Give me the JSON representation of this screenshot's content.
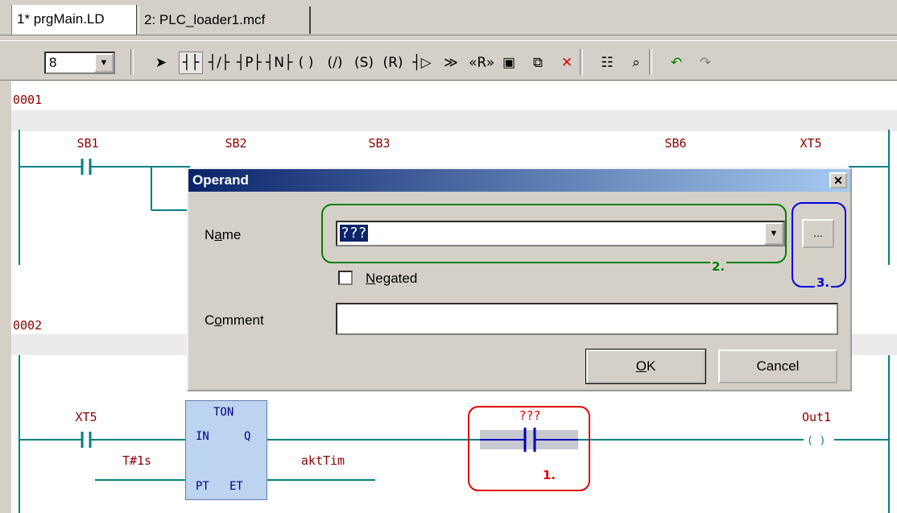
{
  "tabs": [
    {
      "label": "1* prgMain.LD",
      "active": true
    },
    {
      "label": "2: PLC_loader1.mcf",
      "active": false
    }
  ],
  "toolbar": {
    "zoom_value": "8",
    "tools": [
      {
        "name": "pointer-tool",
        "glyph": "➤"
      },
      {
        "name": "contact-tool",
        "glyph": "┤├"
      },
      {
        "name": "negated-contact-tool",
        "glyph": "┤/├"
      },
      {
        "name": "positive-edge-contact-tool",
        "glyph": "┤P├"
      },
      {
        "name": "negative-edge-contact-tool",
        "glyph": "┤N├"
      },
      {
        "name": "coil-tool",
        "glyph": "( )"
      },
      {
        "name": "negated-coil-tool",
        "glyph": "(/)"
      },
      {
        "name": "set-coil-tool",
        "glyph": "(S)"
      },
      {
        "name": "reset-coil-tool",
        "glyph": "(R)"
      },
      {
        "name": "function-block-tool",
        "glyph": "┤▷"
      },
      {
        "name": "jump-tool",
        "glyph": "≫"
      },
      {
        "name": "return-tool",
        "glyph": "«R»"
      },
      {
        "name": "insert-network-tool",
        "glyph": "▣"
      },
      {
        "name": "paste-network-tool",
        "glyph": "⧉"
      },
      {
        "name": "delete-tool",
        "glyph": "✕"
      },
      {
        "name": "variable-list-tool",
        "glyph": "☷"
      },
      {
        "name": "cross-reference-tool",
        "glyph": "⌕"
      },
      {
        "name": "undo-tool",
        "glyph": "↶"
      },
      {
        "name": "redo-tool",
        "glyph": "↷"
      }
    ]
  },
  "editor": {
    "networks": [
      "0001",
      "0002"
    ],
    "net1_vars": [
      "SB1",
      "SB2",
      "SB3",
      "SB6",
      "XT5"
    ],
    "net2_vars": {
      "xt5": "XT5",
      "time_literal": "T#1s",
      "akttim": "aktTim",
      "placeholder": "???",
      "out1": "Out1"
    },
    "fb": {
      "type": "TON",
      "in": "IN",
      "q": "Q",
      "pt": "PT",
      "et": "ET"
    }
  },
  "annotations": {
    "a1": "1.",
    "a2": "2.",
    "a3": "3."
  },
  "dialog": {
    "title": "Operand",
    "close": "✕",
    "name_label_pre": "N",
    "name_label_u": "a",
    "name_label_post": "me",
    "name_value": "???",
    "browse": "...",
    "negated_label_u": "N",
    "negated_label_rest": "egated",
    "negated_checked": false,
    "comment_label_pre": "C",
    "comment_label_u": "o",
    "comment_label_post": "mment",
    "comment_value": "",
    "ok_u": "O",
    "ok_rest": "K",
    "cancel": "Cancel"
  },
  "colors": {
    "rung": "#008080",
    "variable": "#8b0000",
    "annotation_1": "#e00000",
    "annotation_2": "#008000",
    "annotation_3": "#0000e0",
    "title_start": "#0a246a",
    "title_end": "#a6caf0"
  }
}
